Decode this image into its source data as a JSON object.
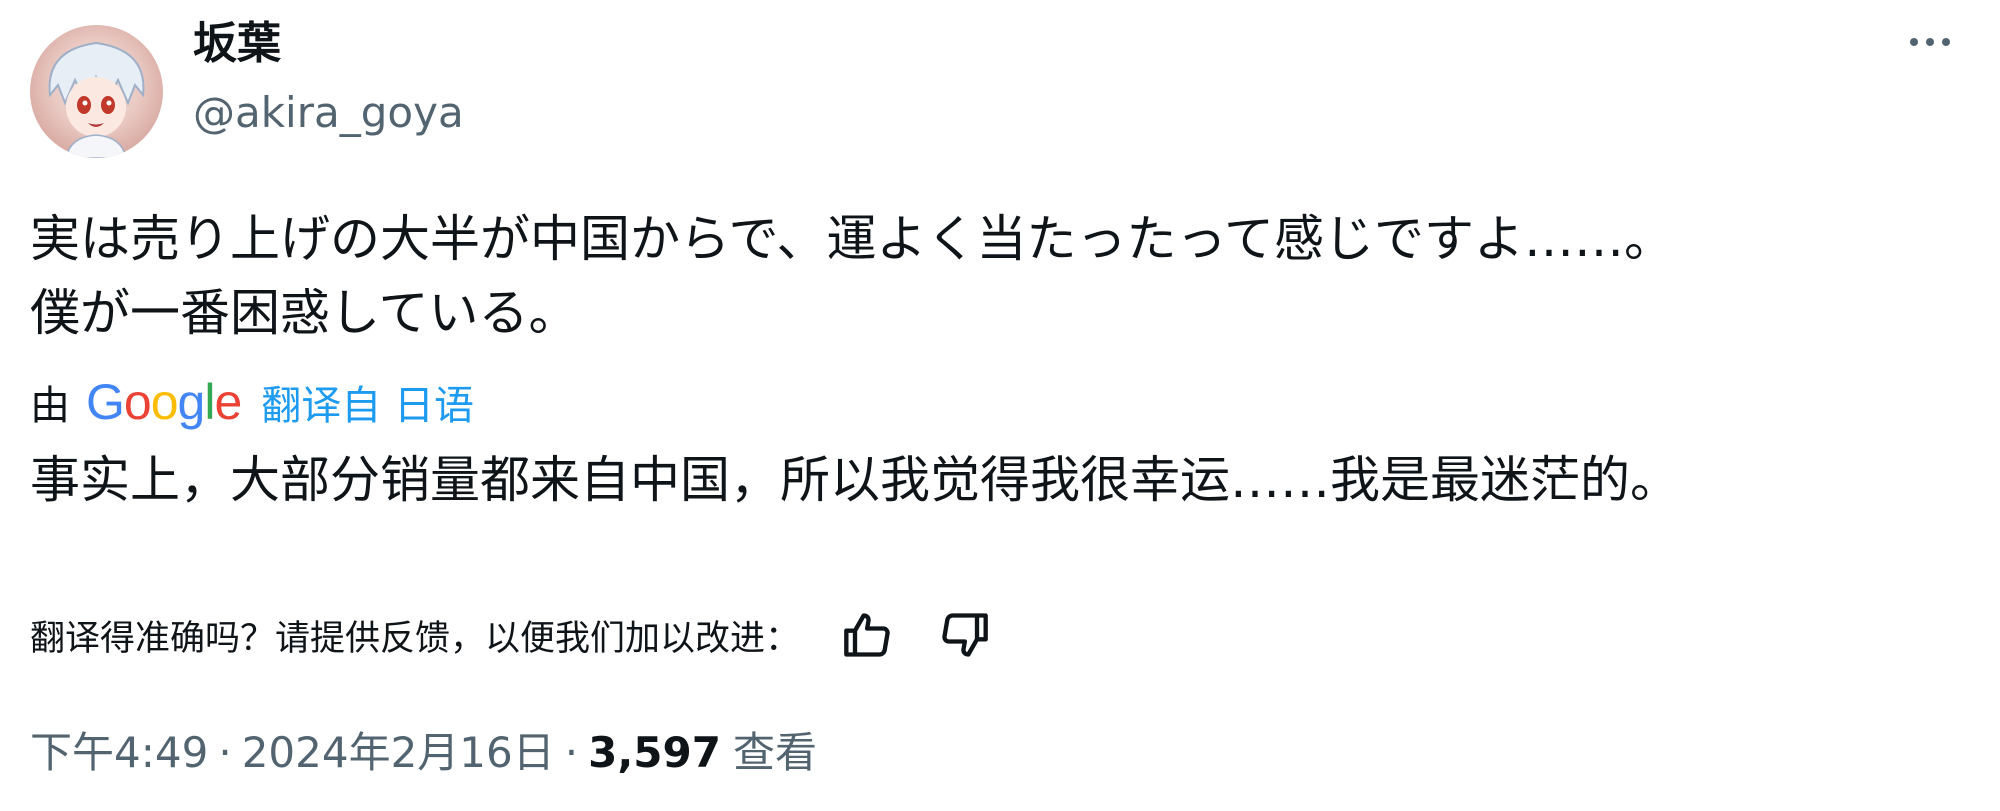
{
  "author": {
    "display_name": "坂葉",
    "handle": "@akira_goya"
  },
  "tweet": {
    "original_lines": [
      "実は売り上げの大半が中国からで、運よく当たったって感じですよ……。",
      "僕が一番困惑している。"
    ],
    "translation_attribution": {
      "by_label": "由",
      "provider": "Google",
      "link_text": "翻译自 日语"
    },
    "translated_text": "事实上，大部分销量都来自中国，所以我觉得我很幸运……我是最迷茫的。",
    "feedback_prompt": "翻译得准确吗？请提供反馈，以便我们加以改进：",
    "meta": {
      "time": "下午4:49",
      "date": "2024年2月16日",
      "views_count": "3,597",
      "views_label": "查看"
    }
  },
  "icons": {
    "more": "more-horizontal-icon",
    "thumbs_up": "thumbs-up-icon",
    "thumbs_down": "thumbs-down-icon"
  },
  "colors": {
    "text_primary": "#0f1419",
    "text_secondary": "#536471",
    "link": "#1d9bf0"
  }
}
